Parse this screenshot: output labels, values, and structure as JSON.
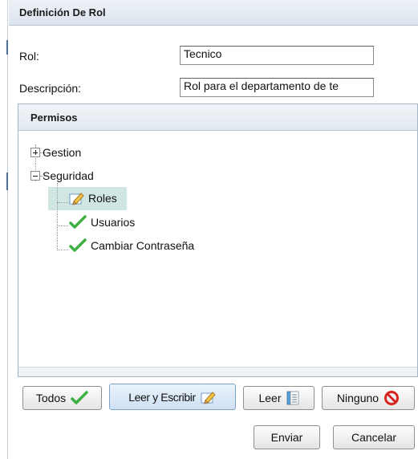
{
  "window": {
    "title": "Definición De Rol"
  },
  "form": {
    "rol_label": "Rol:",
    "rol_value": "Tecnico",
    "descripcion_label": "Descripción:",
    "descripcion_value": "Rol para el departamento de te"
  },
  "permissions": {
    "title": "Permisos",
    "tree": [
      {
        "label": "Gestion",
        "state": "collapsed"
      },
      {
        "label": "Seguridad",
        "state": "expanded",
        "children": [
          {
            "label": "Roles",
            "icon": "pencil-icon",
            "selected": true
          },
          {
            "label": "Usuarios",
            "icon": "check-icon"
          },
          {
            "label": "Cambiar Contraseña",
            "icon": "check-icon"
          }
        ]
      }
    ]
  },
  "buttons": {
    "todos": "Todos",
    "leer_escribir": "Leer y Escribir",
    "leer": "Leer",
    "ninguno": "Ninguno",
    "enviar": "Enviar",
    "cancelar": "Cancelar"
  },
  "colors": {
    "selection": "#cfe6e3",
    "check_green": "#3cb043",
    "ninguno_red": "#d92222"
  }
}
